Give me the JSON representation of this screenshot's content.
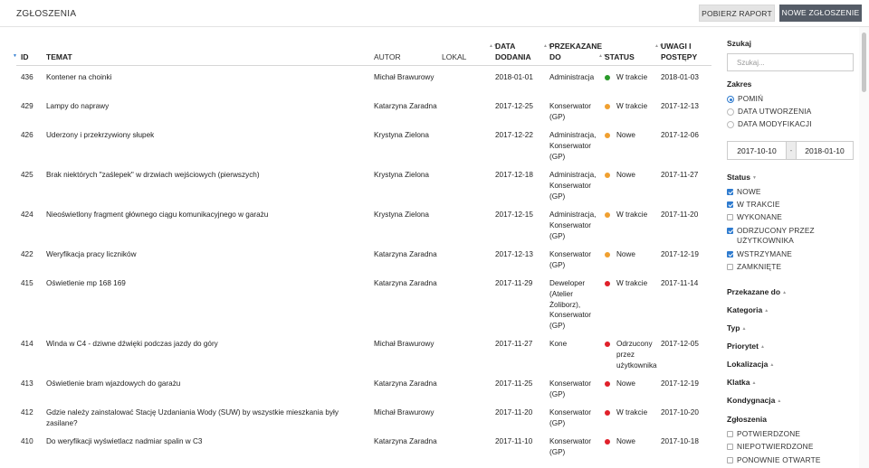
{
  "header": {
    "title": "ZGŁOSZENIA",
    "report_button": "POBIERZ RAPORT",
    "new_button": "NOWE ZGŁOSZENIE"
  },
  "table": {
    "columns": {
      "id": "ID",
      "topic": "TEMAT",
      "author": "AUTOR",
      "local": "LOKAL",
      "date_line1": "DATA",
      "date_line2": "DODANIA",
      "przek_line1": "PRZEKAZANE",
      "przek_line2": "DO",
      "status": "STATUS",
      "uwagi_line1": "UWAGI I",
      "uwagi_line2": "POSTĘPY"
    },
    "rows": [
      {
        "id": "436",
        "topic": "Kontener na choinki",
        "author": "Michał Brawurowy",
        "date": "2018-01-01",
        "przekazane": "Administracja",
        "status": "W trakcie",
        "status_color": "#2a9a2a",
        "uwagi": "2018-01-03"
      },
      {
        "id": "429",
        "topic": "Lampy do naprawy",
        "author": "Katarzyna Zaradna",
        "date": "2017-12-25",
        "przekazane": "Konserwator (GP)",
        "status": "W trakcie",
        "status_color": "#f0a030",
        "uwagi": "2017-12-13"
      },
      {
        "id": "426",
        "topic": "Uderzony i przekrzywiony słupek",
        "author": "Krystyna Zielona",
        "date": "2017-12-22",
        "przekazane": "Administracja, Konserwator (GP)",
        "status": "Nowe",
        "status_color": "#f0a030",
        "uwagi": "2017-12-06"
      },
      {
        "id": "425",
        "topic": "Brak niektórych \"zaślepek\" w drzwiach wejściowych (pierwszych)",
        "author": "Krystyna Zielona",
        "date": "2017-12-18",
        "przekazane": "Administracja, Konserwator (GP)",
        "status": "Nowe",
        "status_color": "#f0a030",
        "uwagi": "2017-11-27"
      },
      {
        "id": "424",
        "topic": "Nieoświetlony fragment głównego ciągu komunikacyjnego w garażu",
        "author": "Krystyna Zielona",
        "date": "2017-12-15",
        "przekazane": "Administracja, Konserwator (GP)",
        "status": "W trakcie",
        "status_color": "#f0a030",
        "uwagi": "2017-11-20"
      },
      {
        "id": "422",
        "topic": "Weryfikacja pracy liczników",
        "author": "Katarzyna Zaradna",
        "date": "2017-12-13",
        "przekazane": "Konserwator (GP)",
        "status": "Nowe",
        "status_color": "#f0a030",
        "uwagi": "2017-12-19"
      },
      {
        "id": "415",
        "topic": "Oświetlenie mp 168 169",
        "author": "Katarzyna Zaradna",
        "date": "2017-11-29",
        "przekazane": "Deweloper (Atelier Żoliborz), Konserwator (GP)",
        "status": "W trakcie",
        "status_color": "#e0202a",
        "uwagi": "2017-11-14"
      },
      {
        "id": "414",
        "topic": "Winda w C4 - dziwne dźwięki podczas jazdy do góry",
        "author": "Michał Brawurowy",
        "date": "2017-11-27",
        "przekazane": "Kone",
        "status": "Odrzucony przez użytkownika",
        "status_color": "#e0202a",
        "uwagi": "2017-12-05"
      },
      {
        "id": "413",
        "topic": "Oświetlenie bram wjazdowych do garażu",
        "author": "Katarzyna Zaradna",
        "date": "2017-11-25",
        "przekazane": "Konserwator (GP)",
        "status": "Nowe",
        "status_color": "#e0202a",
        "uwagi": "2017-12-19"
      },
      {
        "id": "412",
        "topic": "Gdzie należy zainstalować Stację Uzdaniania Wody (SUW) by wszystkie mieszkania były zasilane?",
        "author": "Michał Brawurowy",
        "date": "2017-11-20",
        "przekazane": "Konserwator (GP)",
        "status": "W trakcie",
        "status_color": "#e0202a",
        "uwagi": "2017-10-20"
      },
      {
        "id": "410",
        "topic": "Do weryfikacji wyświetlacz nadmiar spalin w C3",
        "author": "Katarzyna Zaradna",
        "date": "2017-11-10",
        "przekazane": "Konserwator (GP)",
        "status": "Nowe",
        "status_color": "#e0202a",
        "uwagi": "2017-10-18"
      }
    ]
  },
  "sidebar": {
    "search_label": "Szukaj",
    "search_placeholder": "Szukaj...",
    "zakres_label": "Zakres",
    "zakres_options": [
      "POMIŃ",
      "DATA UTWORZENIA",
      "DATA MODYFIKACJI"
    ],
    "date_from": "2017-10-10",
    "date_sep": "-",
    "date_to": "2018-01-10",
    "status_label": "Status",
    "status_options": [
      {
        "label": "NOWE",
        "checked": true
      },
      {
        "label": "W TRAKCIE",
        "checked": true
      },
      {
        "label": "WYKONANE",
        "checked": false
      },
      {
        "label": "ODRZUCONY PRZEZ UŻYTKOWNIKA",
        "checked": true
      },
      {
        "label": "WSTRZYMANE",
        "checked": true
      },
      {
        "label": "ZAMKNIĘTE",
        "checked": false
      }
    ],
    "filters": [
      "Przekazane do",
      "Kategoria",
      "Typ",
      "Priorytet",
      "Lokalizacja",
      "Klatka",
      "Kondygnacja"
    ],
    "zgloszenia_label": "Zgłoszenia",
    "zgloszenia_options": [
      "POTWIERDZONE",
      "NIEPOTWIERDZONE",
      "PONOWNIE OTWARTE"
    ]
  }
}
